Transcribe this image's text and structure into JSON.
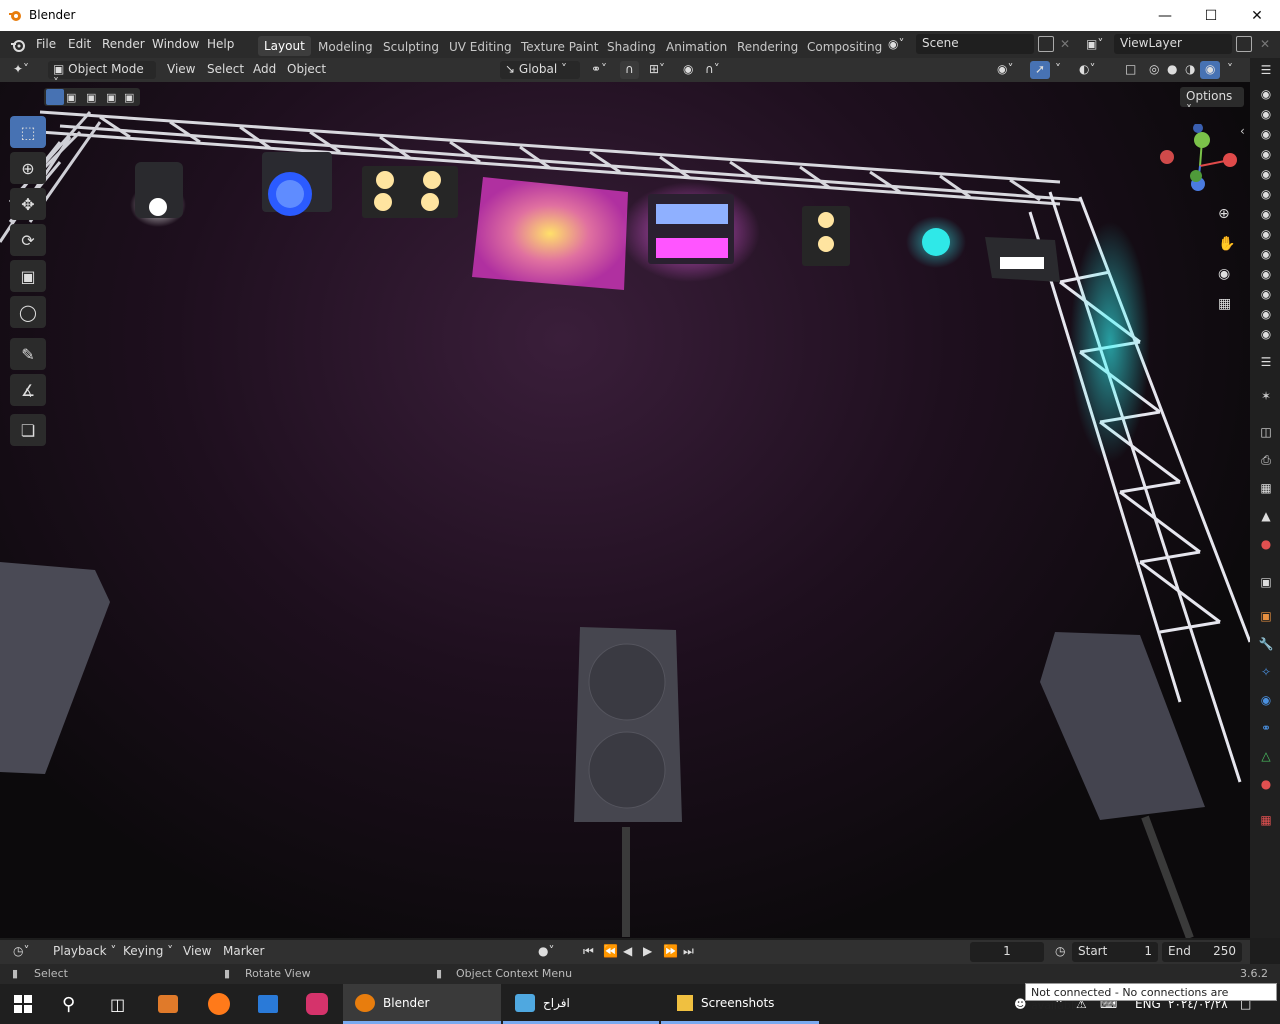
{
  "window": {
    "title": "Blender"
  },
  "menu": {
    "items": [
      "File",
      "Edit",
      "Render",
      "Window",
      "Help"
    ]
  },
  "workspaces": {
    "tabs": [
      "Layout",
      "Modeling",
      "Sculpting",
      "UV Editing",
      "Texture Paint",
      "Shading",
      "Animation",
      "Rendering",
      "Compositing"
    ],
    "active": "Layout"
  },
  "scene": {
    "name": "Scene",
    "view_layer": "ViewLayer"
  },
  "viewport_header": {
    "mode": "Object Mode",
    "menus": [
      "View",
      "Select",
      "Add",
      "Object"
    ],
    "orientation": "Global",
    "options_label": "Options"
  },
  "tools": [
    "select-box-icon",
    "cursor-icon",
    "move-icon",
    "rotate-icon",
    "scale-icon",
    "transform-icon",
    "annotate-icon",
    "measure-icon",
    "add-cube-icon"
  ],
  "timeline": {
    "menus": [
      "Playback",
      "Keying",
      "View",
      "Marker"
    ],
    "current_frame": "1",
    "start_label": "Start",
    "start": "1",
    "end_label": "End",
    "end": "250"
  },
  "statusbar": {
    "select": "Select",
    "rotate": "Rotate View",
    "context": "Object Context Menu",
    "version": "3.6.2"
  },
  "taskbar": {
    "apps": [
      {
        "label": "Blender",
        "icon": "blender-icon"
      },
      {
        "label": "افراح",
        "icon": "app-icon"
      },
      {
        "label": "Screenshots",
        "icon": "folder-icon"
      }
    ],
    "lang": "ENG",
    "date": "٢٠٢٤/٠٢/٢٨",
    "tooltip": "Not connected - No connections are available"
  },
  "colors": {
    "accent": "#4772b3",
    "header": "#303030",
    "topbar": "#2b2b2b"
  }
}
